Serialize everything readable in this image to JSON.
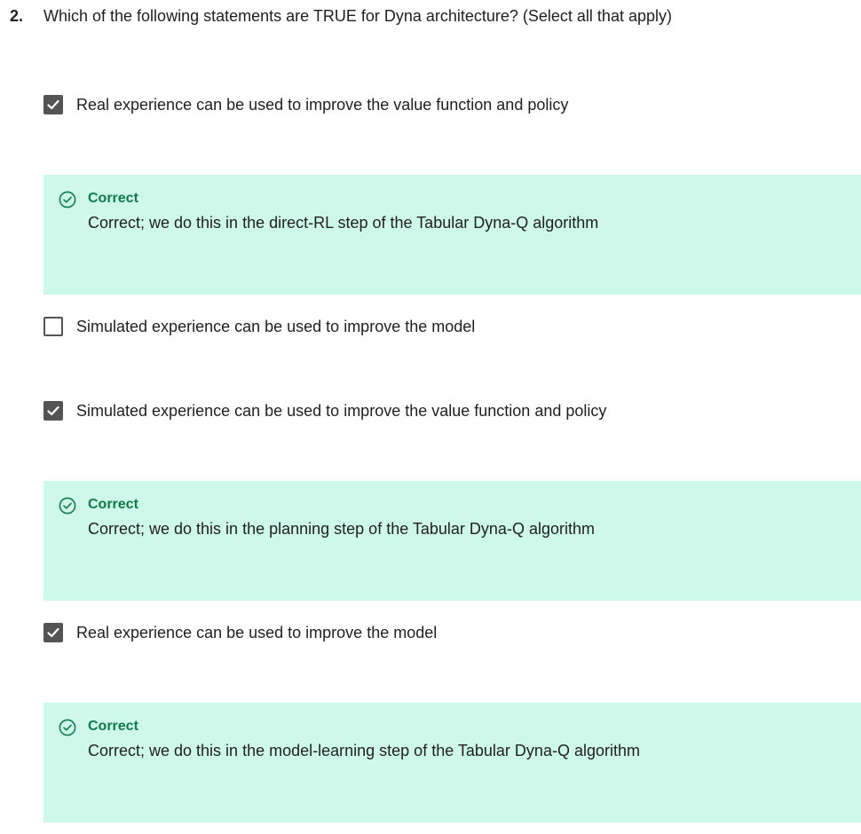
{
  "question": {
    "number": "2.",
    "text": "Which of the following statements are TRUE for Dyna architecture? (Select all that apply)"
  },
  "colors": {
    "feedback_bg": "#cef8ea",
    "correct_green": "#0f7a4b",
    "checkbox_dark": "#545454"
  },
  "options": [
    {
      "label": "Real experience can be used to improve the value function and policy",
      "checked": true,
      "feedback": {
        "title": "Correct",
        "text": "Correct; we do this in the direct-RL step of the Tabular Dyna-Q algorithm",
        "icon": "check-circle-icon"
      }
    },
    {
      "label": "Simulated experience can be used to improve the model",
      "checked": false
    },
    {
      "label": "Simulated experience can be used to improve the value function and policy",
      "checked": true,
      "feedback": {
        "title": "Correct",
        "text": "Correct; we do this in the planning step of the Tabular Dyna-Q algorithm",
        "icon": "check-circle-icon"
      }
    },
    {
      "label": "Real experience can be used to improve the model",
      "checked": true,
      "feedback": {
        "title": "Correct",
        "text": "Correct; we do this in the model-learning step of the Tabular Dyna-Q algorithm",
        "icon": "check-circle-icon"
      }
    }
  ]
}
